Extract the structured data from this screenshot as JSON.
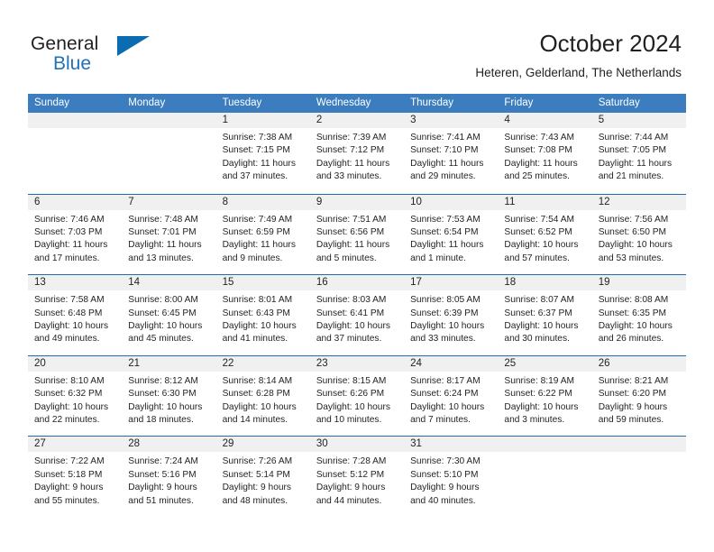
{
  "brand": {
    "word_one": "General",
    "word_two": "Blue",
    "flag_icon": "triangle-flag-icon",
    "accent_color": "#0b6cb1"
  },
  "header": {
    "title": "October 2024",
    "subtitle": "Heteren, Gelderland, The Netherlands"
  },
  "theme": {
    "header_blue": "#3b7dbf",
    "separator_blue": "#1f6cb0",
    "date_band_gray": "#f0f0f0",
    "text": "#231f20"
  },
  "calendar": {
    "weekday_headers": [
      "Sunday",
      "Monday",
      "Tuesday",
      "Wednesday",
      "Thursday",
      "Friday",
      "Saturday"
    ],
    "weeks": [
      [
        {
          "date": "",
          "lines": []
        },
        {
          "date": "",
          "lines": []
        },
        {
          "date": "1",
          "lines": [
            "Sunrise: 7:38 AM",
            "Sunset: 7:15 PM",
            "Daylight: 11 hours",
            "and 37 minutes."
          ]
        },
        {
          "date": "2",
          "lines": [
            "Sunrise: 7:39 AM",
            "Sunset: 7:12 PM",
            "Daylight: 11 hours",
            "and 33 minutes."
          ]
        },
        {
          "date": "3",
          "lines": [
            "Sunrise: 7:41 AM",
            "Sunset: 7:10 PM",
            "Daylight: 11 hours",
            "and 29 minutes."
          ]
        },
        {
          "date": "4",
          "lines": [
            "Sunrise: 7:43 AM",
            "Sunset: 7:08 PM",
            "Daylight: 11 hours",
            "and 25 minutes."
          ]
        },
        {
          "date": "5",
          "lines": [
            "Sunrise: 7:44 AM",
            "Sunset: 7:05 PM",
            "Daylight: 11 hours",
            "and 21 minutes."
          ]
        }
      ],
      [
        {
          "date": "6",
          "lines": [
            "Sunrise: 7:46 AM",
            "Sunset: 7:03 PM",
            "Daylight: 11 hours",
            "and 17 minutes."
          ]
        },
        {
          "date": "7",
          "lines": [
            "Sunrise: 7:48 AM",
            "Sunset: 7:01 PM",
            "Daylight: 11 hours",
            "and 13 minutes."
          ]
        },
        {
          "date": "8",
          "lines": [
            "Sunrise: 7:49 AM",
            "Sunset: 6:59 PM",
            "Daylight: 11 hours",
            "and 9 minutes."
          ]
        },
        {
          "date": "9",
          "lines": [
            "Sunrise: 7:51 AM",
            "Sunset: 6:56 PM",
            "Daylight: 11 hours",
            "and 5 minutes."
          ]
        },
        {
          "date": "10",
          "lines": [
            "Sunrise: 7:53 AM",
            "Sunset: 6:54 PM",
            "Daylight: 11 hours",
            "and 1 minute."
          ]
        },
        {
          "date": "11",
          "lines": [
            "Sunrise: 7:54 AM",
            "Sunset: 6:52 PM",
            "Daylight: 10 hours",
            "and 57 minutes."
          ]
        },
        {
          "date": "12",
          "lines": [
            "Sunrise: 7:56 AM",
            "Sunset: 6:50 PM",
            "Daylight: 10 hours",
            "and 53 minutes."
          ]
        }
      ],
      [
        {
          "date": "13",
          "lines": [
            "Sunrise: 7:58 AM",
            "Sunset: 6:48 PM",
            "Daylight: 10 hours",
            "and 49 minutes."
          ]
        },
        {
          "date": "14",
          "lines": [
            "Sunrise: 8:00 AM",
            "Sunset: 6:45 PM",
            "Daylight: 10 hours",
            "and 45 minutes."
          ]
        },
        {
          "date": "15",
          "lines": [
            "Sunrise: 8:01 AM",
            "Sunset: 6:43 PM",
            "Daylight: 10 hours",
            "and 41 minutes."
          ]
        },
        {
          "date": "16",
          "lines": [
            "Sunrise: 8:03 AM",
            "Sunset: 6:41 PM",
            "Daylight: 10 hours",
            "and 37 minutes."
          ]
        },
        {
          "date": "17",
          "lines": [
            "Sunrise: 8:05 AM",
            "Sunset: 6:39 PM",
            "Daylight: 10 hours",
            "and 33 minutes."
          ]
        },
        {
          "date": "18",
          "lines": [
            "Sunrise: 8:07 AM",
            "Sunset: 6:37 PM",
            "Daylight: 10 hours",
            "and 30 minutes."
          ]
        },
        {
          "date": "19",
          "lines": [
            "Sunrise: 8:08 AM",
            "Sunset: 6:35 PM",
            "Daylight: 10 hours",
            "and 26 minutes."
          ]
        }
      ],
      [
        {
          "date": "20",
          "lines": [
            "Sunrise: 8:10 AM",
            "Sunset: 6:32 PM",
            "Daylight: 10 hours",
            "and 22 minutes."
          ]
        },
        {
          "date": "21",
          "lines": [
            "Sunrise: 8:12 AM",
            "Sunset: 6:30 PM",
            "Daylight: 10 hours",
            "and 18 minutes."
          ]
        },
        {
          "date": "22",
          "lines": [
            "Sunrise: 8:14 AM",
            "Sunset: 6:28 PM",
            "Daylight: 10 hours",
            "and 14 minutes."
          ]
        },
        {
          "date": "23",
          "lines": [
            "Sunrise: 8:15 AM",
            "Sunset: 6:26 PM",
            "Daylight: 10 hours",
            "and 10 minutes."
          ]
        },
        {
          "date": "24",
          "lines": [
            "Sunrise: 8:17 AM",
            "Sunset: 6:24 PM",
            "Daylight: 10 hours",
            "and 7 minutes."
          ]
        },
        {
          "date": "25",
          "lines": [
            "Sunrise: 8:19 AM",
            "Sunset: 6:22 PM",
            "Daylight: 10 hours",
            "and 3 minutes."
          ]
        },
        {
          "date": "26",
          "lines": [
            "Sunrise: 8:21 AM",
            "Sunset: 6:20 PM",
            "Daylight: 9 hours",
            "and 59 minutes."
          ]
        }
      ],
      [
        {
          "date": "27",
          "lines": [
            "Sunrise: 7:22 AM",
            "Sunset: 5:18 PM",
            "Daylight: 9 hours",
            "and 55 minutes."
          ]
        },
        {
          "date": "28",
          "lines": [
            "Sunrise: 7:24 AM",
            "Sunset: 5:16 PM",
            "Daylight: 9 hours",
            "and 51 minutes."
          ]
        },
        {
          "date": "29",
          "lines": [
            "Sunrise: 7:26 AM",
            "Sunset: 5:14 PM",
            "Daylight: 9 hours",
            "and 48 minutes."
          ]
        },
        {
          "date": "30",
          "lines": [
            "Sunrise: 7:28 AM",
            "Sunset: 5:12 PM",
            "Daylight: 9 hours",
            "and 44 minutes."
          ]
        },
        {
          "date": "31",
          "lines": [
            "Sunrise: 7:30 AM",
            "Sunset: 5:10 PM",
            "Daylight: 9 hours",
            "and 40 minutes."
          ]
        },
        {
          "date": "",
          "lines": []
        },
        {
          "date": "",
          "lines": []
        }
      ]
    ]
  }
}
